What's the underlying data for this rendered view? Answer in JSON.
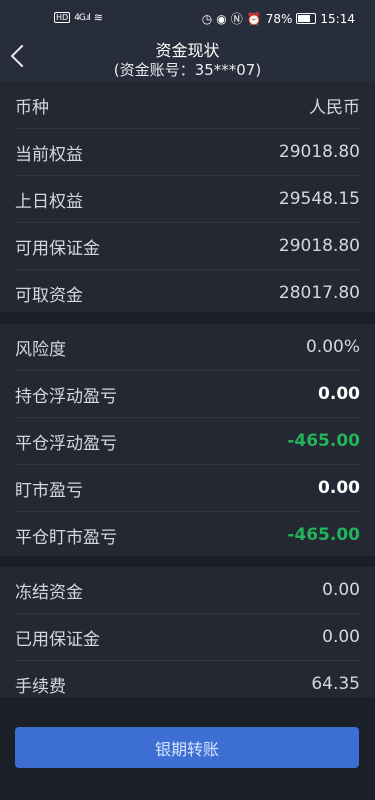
{
  "status": {
    "time": "15:14",
    "battery": "78%",
    "battery_level": 0.78,
    "left_label": "HD",
    "signal": "4G"
  },
  "header": {
    "title": "资金现状",
    "subtitle": "(资金账号：35***07)"
  },
  "section1": [
    {
      "label": "币种",
      "value": "人民币"
    },
    {
      "label": "当前权益",
      "value": "29018.80"
    },
    {
      "label": "上日权益",
      "value": "29548.15"
    },
    {
      "label": "可用保证金",
      "value": "29018.80"
    },
    {
      "label": "可取资金",
      "value": "28017.80"
    }
  ],
  "section2": [
    {
      "label": "风险度",
      "value": "0.00%"
    },
    {
      "label": "持仓浮动盈亏",
      "value": "0.00"
    },
    {
      "label": "平仓浮动盈亏",
      "value": "-465.00"
    },
    {
      "label": "盯市盈亏",
      "value": "0.00"
    },
    {
      "label": "平仓盯市盈亏",
      "value": "-465.00"
    }
  ],
  "section3": [
    {
      "label": "冻结资金",
      "value": "0.00"
    },
    {
      "label": "已用保证金",
      "value": "0.00"
    },
    {
      "label": "手续费",
      "value": "64.35"
    }
  ],
  "footer": {
    "button_label": "银期转账"
  },
  "colors": {
    "negative": "#23b35a",
    "accent": "#3c6ed3"
  }
}
